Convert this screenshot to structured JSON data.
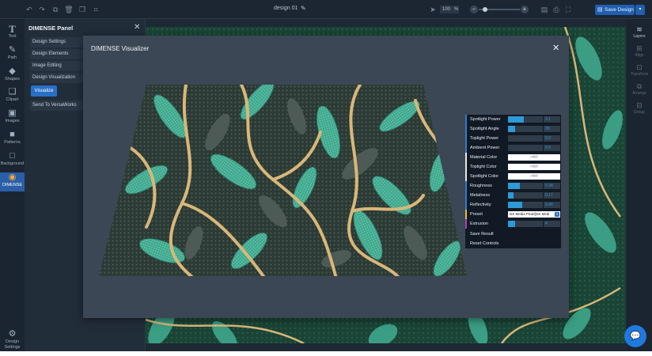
{
  "toolbar": {
    "document_title": "design 01",
    "zoom_value": "100",
    "zoom_unit": "%",
    "save_label": "Save Design",
    "icons": [
      "undo-icon",
      "redo-icon",
      "copy-icon",
      "trash-icon",
      "duplicate-icon",
      "crop-icon",
      "pointer-icon",
      "save-disk-icon",
      "print-icon"
    ]
  },
  "left_rail": {
    "items": [
      {
        "label": "Text",
        "glyph": "T",
        "icon": "text-icon"
      },
      {
        "label": "Path",
        "glyph": "✎",
        "icon": "path-icon"
      },
      {
        "label": "Shapes",
        "glyph": "◆",
        "icon": "shapes-icon"
      },
      {
        "label": "Clipart",
        "glyph": "❏",
        "icon": "clipart-icon"
      },
      {
        "label": "Images",
        "glyph": "▣",
        "icon": "images-icon"
      },
      {
        "label": "Patterns",
        "glyph": "■",
        "icon": "patterns-icon"
      },
      {
        "label": "Background",
        "glyph": "□",
        "icon": "background-icon"
      },
      {
        "label": "DIMENSE",
        "glyph": "◉",
        "icon": "dimense-icon"
      }
    ],
    "footer": {
      "label_line1": "Design",
      "label_line2": "Settings",
      "glyph": "⚙"
    }
  },
  "panel": {
    "title": "DIMENSE Panel",
    "items": [
      "Design Settings",
      "Design Elements",
      "Image Editing",
      "Design Visualization"
    ],
    "visualize_label": "Visualize",
    "send_label": "Send To VersaWorks"
  },
  "right_rail": {
    "items": [
      {
        "label": "Layers",
        "glyph": "≋",
        "icon": "layers-icon"
      },
      {
        "label": "Align",
        "glyph": "⊞",
        "icon": "align-icon"
      },
      {
        "label": "Transform",
        "glyph": "⊡",
        "icon": "transform-icon"
      },
      {
        "label": "Arrange",
        "glyph": "⧉",
        "icon": "arrange-icon"
      },
      {
        "label": "Group",
        "glyph": "⊟",
        "icon": "group-icon"
      }
    ]
  },
  "modal": {
    "title": "DIMENSE Visualizer"
  },
  "controls": {
    "spotlight_power": {
      "label": "Spotlight Power",
      "value": "3.1",
      "fraction": 0.45
    },
    "spotlight_angle": {
      "label": "Spotlight Angle",
      "value": "30",
      "fraction": 0.2
    },
    "toplight_power": {
      "label": "Toplight Power",
      "value": "0.0",
      "fraction": 0.0
    },
    "ambient_power": {
      "label": "Ambient Power",
      "value": "0.0",
      "fraction": 0.0
    },
    "material_color": {
      "label": "Material Color",
      "value": "#ffffff"
    },
    "toplight_color": {
      "label": "Toplight Color",
      "value": "#ffffff"
    },
    "spotlight_color": {
      "label": "Spotlight Color",
      "value": "#ffffff"
    },
    "roughness": {
      "label": "Roughness",
      "value": "0.34",
      "fraction": 0.34
    },
    "metalness": {
      "label": "Metalness",
      "value": "0.17",
      "fraction": 0.17
    },
    "reflectivity": {
      "label": "Reflectivity",
      "value": "0.40",
      "fraction": 0.4
    },
    "preset": {
      "label": "Preset",
      "value": "DS Media Pearl(DS Medi"
    },
    "extrusion": {
      "label": "Extrusion",
      "value": "4",
      "fraction": 0.2
    },
    "save_result": "Save Result",
    "reset_controls": "Reset Controls"
  },
  "colors": {
    "accent": "#2a6fc6",
    "teal_leaf": "#3fa88e",
    "dark_leaf": "#1f4f40",
    "gold_vine": "#d9b778",
    "modal_bg": "#3b4754"
  }
}
